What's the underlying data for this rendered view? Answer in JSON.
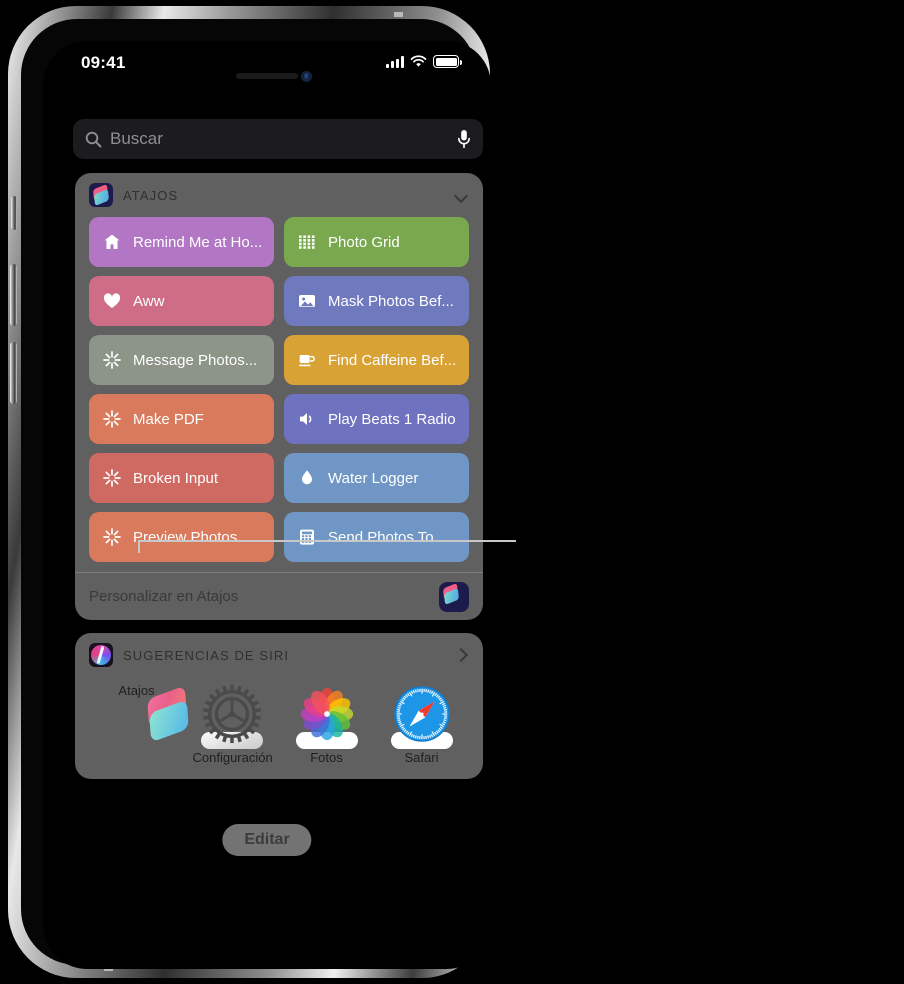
{
  "status_bar": {
    "time": "09:41",
    "signal_icon": "cellular-bars-icon",
    "wifi_icon": "wifi-icon",
    "battery_icon": "battery-full-icon"
  },
  "search": {
    "placeholder": "Buscar",
    "search_icon": "search-icon",
    "mic_icon": "microphone-icon"
  },
  "shortcuts_widget": {
    "title": "ATAJOS",
    "app_icon": "shortcuts-app-icon",
    "collapse_icon": "chevron-down-icon",
    "tiles": [
      {
        "label": "Remind Me at Ho...",
        "color": "#b276c4",
        "icon": "house-icon"
      },
      {
        "label": "Photo Grid",
        "color": "#7aa84f",
        "icon": "grid-dots-icon"
      },
      {
        "label": "Aww",
        "color": "#cf6d86",
        "icon": "heart-icon"
      },
      {
        "label": "Mask Photos Bef...",
        "color": "#6f79bd",
        "icon": "photo-icon"
      },
      {
        "label": "Message Photos...",
        "color": "#8d9488",
        "icon": "sparkle-icon"
      },
      {
        "label": "Find Caffeine Bef...",
        "color": "#d9a235",
        "icon": "coffee-cup-icon"
      },
      {
        "label": "Make PDF",
        "color": "#d97a5c",
        "icon": "sparkle-icon"
      },
      {
        "label": "Play Beats 1 Radio",
        "color": "#6f73bf",
        "icon": "speaker-icon"
      },
      {
        "label": "Broken Input",
        "color": "#cf6a63",
        "icon": "sparkle-icon"
      },
      {
        "label": "Water Logger",
        "color": "#6f96c4",
        "icon": "water-drop-icon"
      },
      {
        "label": "Preview Photos",
        "color": "#d97a5c",
        "icon": "sparkle-icon"
      },
      {
        "label": "Send Photos To...",
        "color": "#6f96c4",
        "icon": "calculator-icon"
      }
    ],
    "footer_label": "Personalizar en Atajos",
    "footer_icon": "shortcuts-app-icon"
  },
  "siri_widget": {
    "title": "SUGERENCIAS DE SIRI",
    "app_icon": "siri-icon",
    "disclosure_icon": "chevron-right-icon",
    "apps": [
      {
        "label": "Atajos",
        "icon": "shortcuts-app-icon"
      },
      {
        "label": "Configuración",
        "icon": "settings-gear-icon"
      },
      {
        "label": "Fotos",
        "icon": "photos-app-icon"
      },
      {
        "label": "Safari",
        "icon": "safari-compass-icon"
      }
    ]
  },
  "edit_button": {
    "label": "Editar"
  },
  "colors": {
    "widget_background": "#787878",
    "search_background": "#1c1c1e",
    "screen_background": "#000000"
  }
}
